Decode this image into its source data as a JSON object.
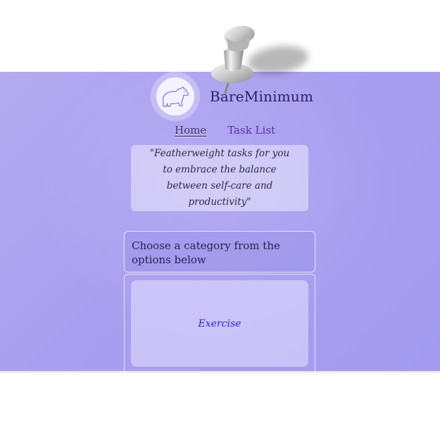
{
  "app": {
    "brand": "BareMinimum",
    "logo_icon": "polar-bear-icon",
    "pin_icon": "pushpin-icon"
  },
  "nav": {
    "home_label": "Home",
    "tasks_label": "Task List"
  },
  "quote": {
    "text": "\"Featherweight tasks for you to embrace the balance between self-care and productivity\""
  },
  "prompt": {
    "text": "Choose a category from the options below"
  },
  "categories": [
    {
      "label": "Exercise"
    }
  ],
  "colors": {
    "board": "#a99ff0",
    "brand_text": "#2b1f63",
    "nav_link": "#5b2fa0",
    "category_text": "#3021c8"
  }
}
